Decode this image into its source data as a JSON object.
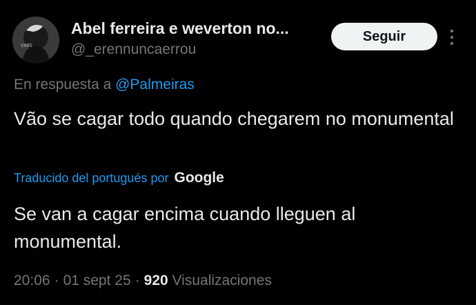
{
  "tweet": {
    "author": {
      "display_name": "Abel ferreira e weverton no...",
      "handle": "@_erennuncaerrou",
      "avatar_text": "VANS"
    },
    "follow_label": "Seguir",
    "more_icon": "more-vertical-icon",
    "reply": {
      "prefix": "En respuesta a",
      "mention": "@Palmeiras"
    },
    "text": "Vão se cagar todo quando chegarem no monumental",
    "translation": {
      "label": "Traducido del portugués por",
      "provider": "Google",
      "text": "Se van a cagar encima cuando lleguen al monumental."
    },
    "meta": {
      "time": "20:06",
      "date": "01 sept 25",
      "views_count": "920",
      "views_label": "Visualizaciones"
    }
  },
  "colors": {
    "background": "#000000",
    "primary_text": "#e7e9ea",
    "secondary_text": "#71767b",
    "link": "#1d9bf0",
    "button_bg": "#eff3f4"
  }
}
